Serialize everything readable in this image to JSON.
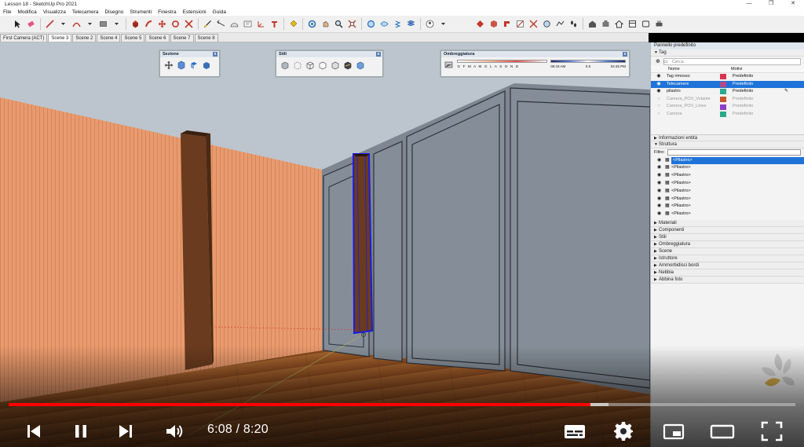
{
  "window": {
    "title": "Lesson 18 - SketchUp Pro 2021",
    "controls": [
      "—",
      "❐",
      "✕"
    ]
  },
  "menu": [
    "File",
    "Modifica",
    "Visualizza",
    "Telecamera",
    "Disegno",
    "Strumenti",
    "Finestra",
    "Estensioni",
    "Guida"
  ],
  "scene_tabs": [
    {
      "label": "First Camera (ACT)",
      "active": false
    },
    {
      "label": "Scene 3",
      "active": true
    },
    {
      "label": "Scene 2",
      "active": false
    },
    {
      "label": "Scene 4",
      "active": false
    },
    {
      "label": "Scene 5",
      "active": false
    },
    {
      "label": "Scene 6",
      "active": false
    },
    {
      "label": "Scene 7",
      "active": false
    },
    {
      "label": "Scene 8",
      "active": false
    }
  ],
  "panels": {
    "sezione": {
      "title": "Sezione",
      "close": "x"
    },
    "stili": {
      "title": "Stili",
      "close": "x"
    },
    "ombreggiatura": {
      "title": "Ombreggiatura",
      "close": "x",
      "months": "G F M A M G L A S O N D",
      "time_start": "06:43 AM",
      "mid_value": "0.5",
      "time_end": "04:45 PM"
    }
  },
  "tray": {
    "title": "Pannello predefinito",
    "tag": {
      "header": "Tag",
      "search_placeholder": "Cerca",
      "col_name": "Nome",
      "col_style": "Motivi",
      "rows": [
        {
          "name": "Tag rimosso",
          "style": "Predefinito",
          "color": "#d9344f",
          "selected": false,
          "dim": false
        },
        {
          "name": "Telecamere",
          "style": "Predefinito",
          "color": "#b24a8a",
          "selected": true,
          "dim": false
        },
        {
          "name": "pilastro",
          "style": "Predefinito",
          "color": "#2aa88c",
          "selected": false,
          "dim": false
        },
        {
          "name": "Camera_POV_Volante",
          "style": "Predefinito",
          "color": "#c8562c",
          "selected": false,
          "dim": true
        },
        {
          "name": "Camera_POV_Lines",
          "style": "Predefinito",
          "color": "#8b3ec9",
          "selected": false,
          "dim": true
        },
        {
          "name": "Camera",
          "style": "Predefinito",
          "color": "#2aa88c",
          "selected": false,
          "dim": true
        }
      ]
    },
    "info_entita": "Informazioni entità",
    "struttura": {
      "header": "Struttura",
      "filter_label": "Filtro:",
      "items": [
        "<Pilastro>",
        "<Pilastro>",
        "<Pilastro>",
        "<Pilastro>",
        "<Pilastro>",
        "<Pilastro>",
        "<Pilastro>",
        "<Pilastro>"
      ]
    },
    "sections": [
      "Materiali",
      "Componenti",
      "Stili",
      "Ombreggiatura",
      "Scene",
      "Istruttore",
      "Ammorbidisci bordi",
      "Nebbia",
      "Abbina foto"
    ]
  },
  "player": {
    "time": "6:08 / 8:20",
    "progress": 0.74,
    "buffered": 0.762,
    "accent": "#ff0000"
  }
}
